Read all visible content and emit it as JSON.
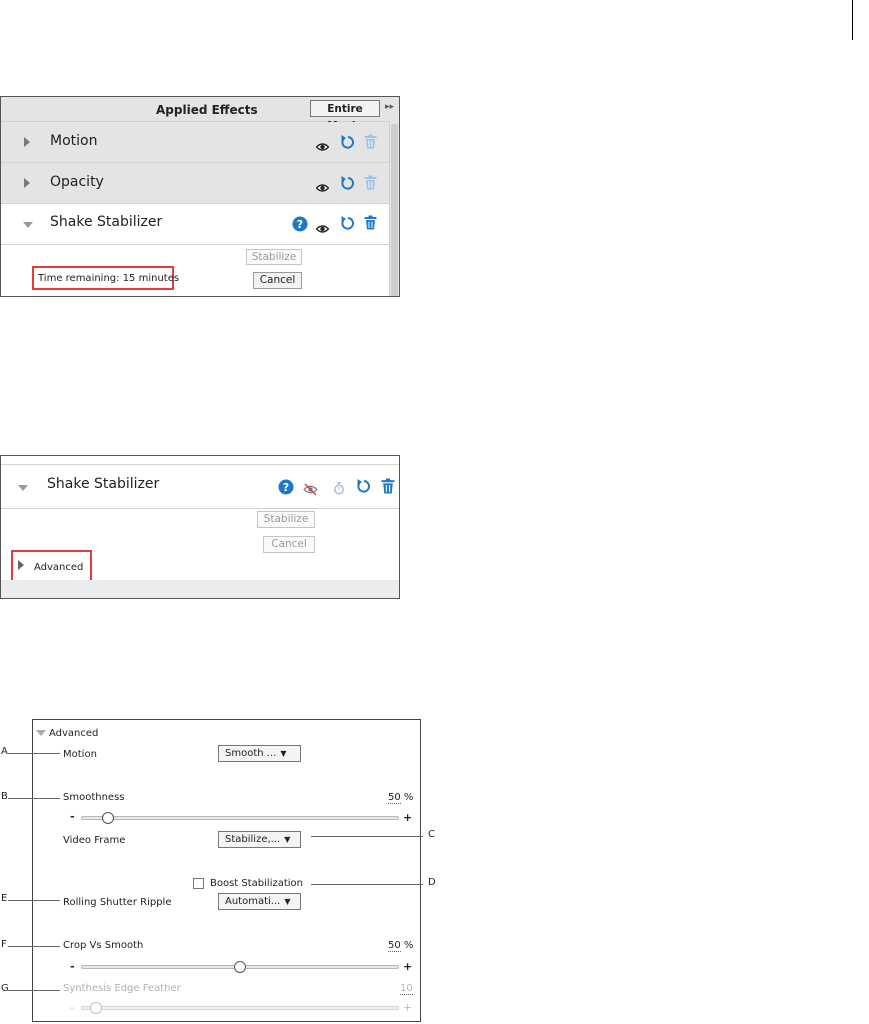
{
  "panel1": {
    "header_title": "Applied Effects",
    "scope_button": "Entire Movie",
    "effects": [
      {
        "label": "Motion"
      },
      {
        "label": "Opacity"
      },
      {
        "label": "Shake Stabilizer"
      }
    ],
    "stabilize_button": "Stabilize",
    "cancel_button": "Cancel",
    "status_text": "Time remaining: 15 minutes"
  },
  "panel2": {
    "effect_label": "Shake Stabilizer",
    "stabilize_button": "Stabilize",
    "cancel_button": "Cancel",
    "advanced_label": "Advanced"
  },
  "panel3": {
    "advanced_label": "Advanced",
    "motion": {
      "label": "Motion",
      "value": "Smooth ..."
    },
    "smoothness": {
      "label": "Smoothness",
      "value": "50",
      "unit": "%",
      "level": 0.07
    },
    "video_frame": {
      "label": "Video Frame",
      "value": "Stabilize,..."
    },
    "boost": {
      "label": "Boost Stabilization",
      "checked": false
    },
    "rolling_shutter": {
      "label": "Rolling Shutter Ripple",
      "value": "Automati..."
    },
    "crop_vs_smooth": {
      "label": "Crop Vs Smooth",
      "value": "50",
      "unit": "%",
      "level": 0.5
    },
    "edge_feather": {
      "label": "Synthesis Edge Feather",
      "value": "10",
      "level": 0.03
    },
    "minus": "-",
    "plus": "+",
    "callouts": {
      "A": "A",
      "B": "B",
      "C": "C",
      "D": "D",
      "E": "E",
      "F": "F",
      "G": "G"
    }
  },
  "colors": {
    "accent_blue": "#1f78c8",
    "highlight_red": "#e53b3b"
  }
}
